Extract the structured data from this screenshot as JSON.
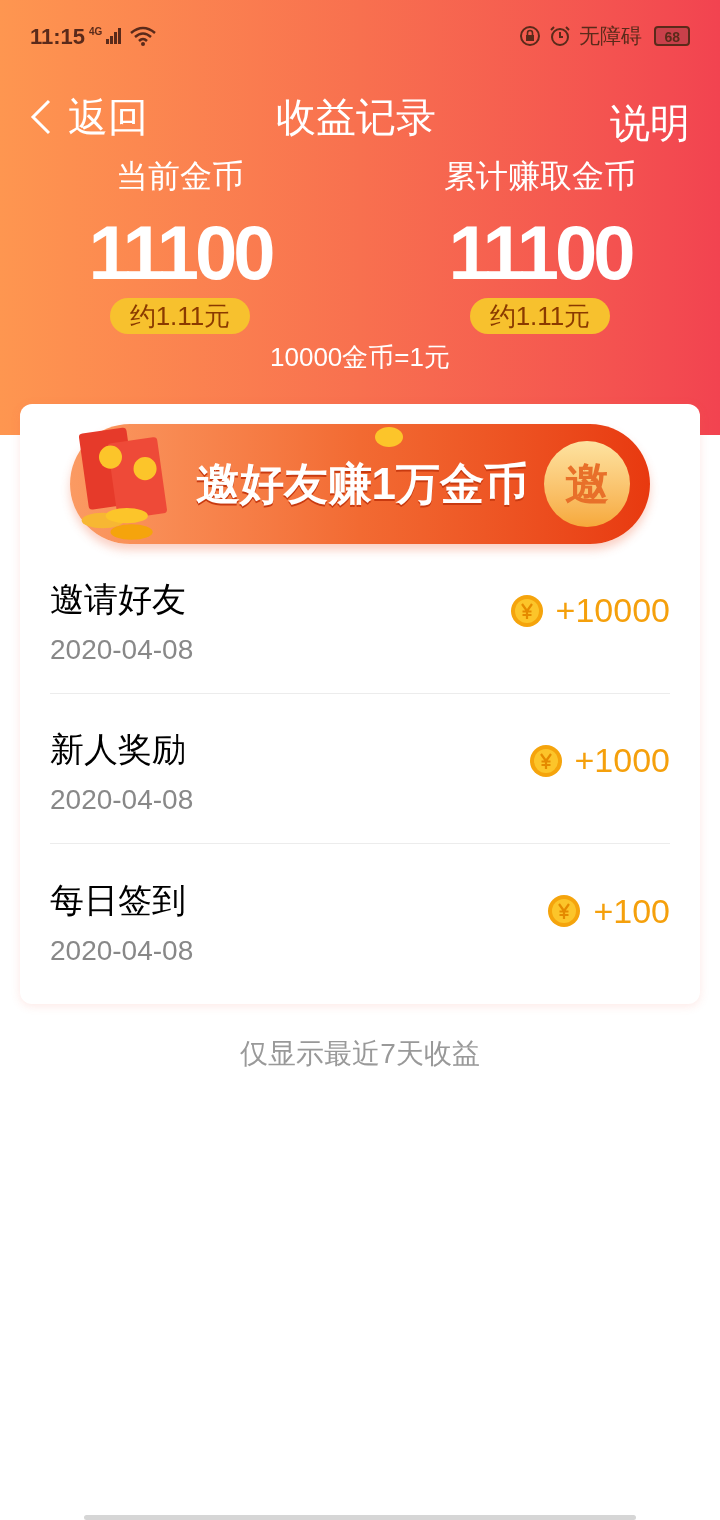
{
  "status_bar": {
    "time": "11:15",
    "network": "4G",
    "accessibility": "无障碍",
    "battery": "68"
  },
  "nav": {
    "back": "返回",
    "title": "收益记录",
    "help": "说明"
  },
  "summary": [
    {
      "label": "当前金币",
      "value": "11100",
      "approx": "约1.11元"
    },
    {
      "label": "累计赚取金币",
      "value": "11100",
      "approx": "约1.11元"
    }
  ],
  "rate": "10000金币=1元",
  "banner": {
    "text": "邀好友赚1万金币",
    "badge": "邀"
  },
  "records": [
    {
      "title": "邀请好友",
      "date": "2020-04-08",
      "amount": "+10000"
    },
    {
      "title": "新人奖励",
      "date": "2020-04-08",
      "amount": "+1000"
    },
    {
      "title": "每日签到",
      "date": "2020-04-08",
      "amount": "+100"
    }
  ],
  "footer": "仅显示最近7天收益"
}
